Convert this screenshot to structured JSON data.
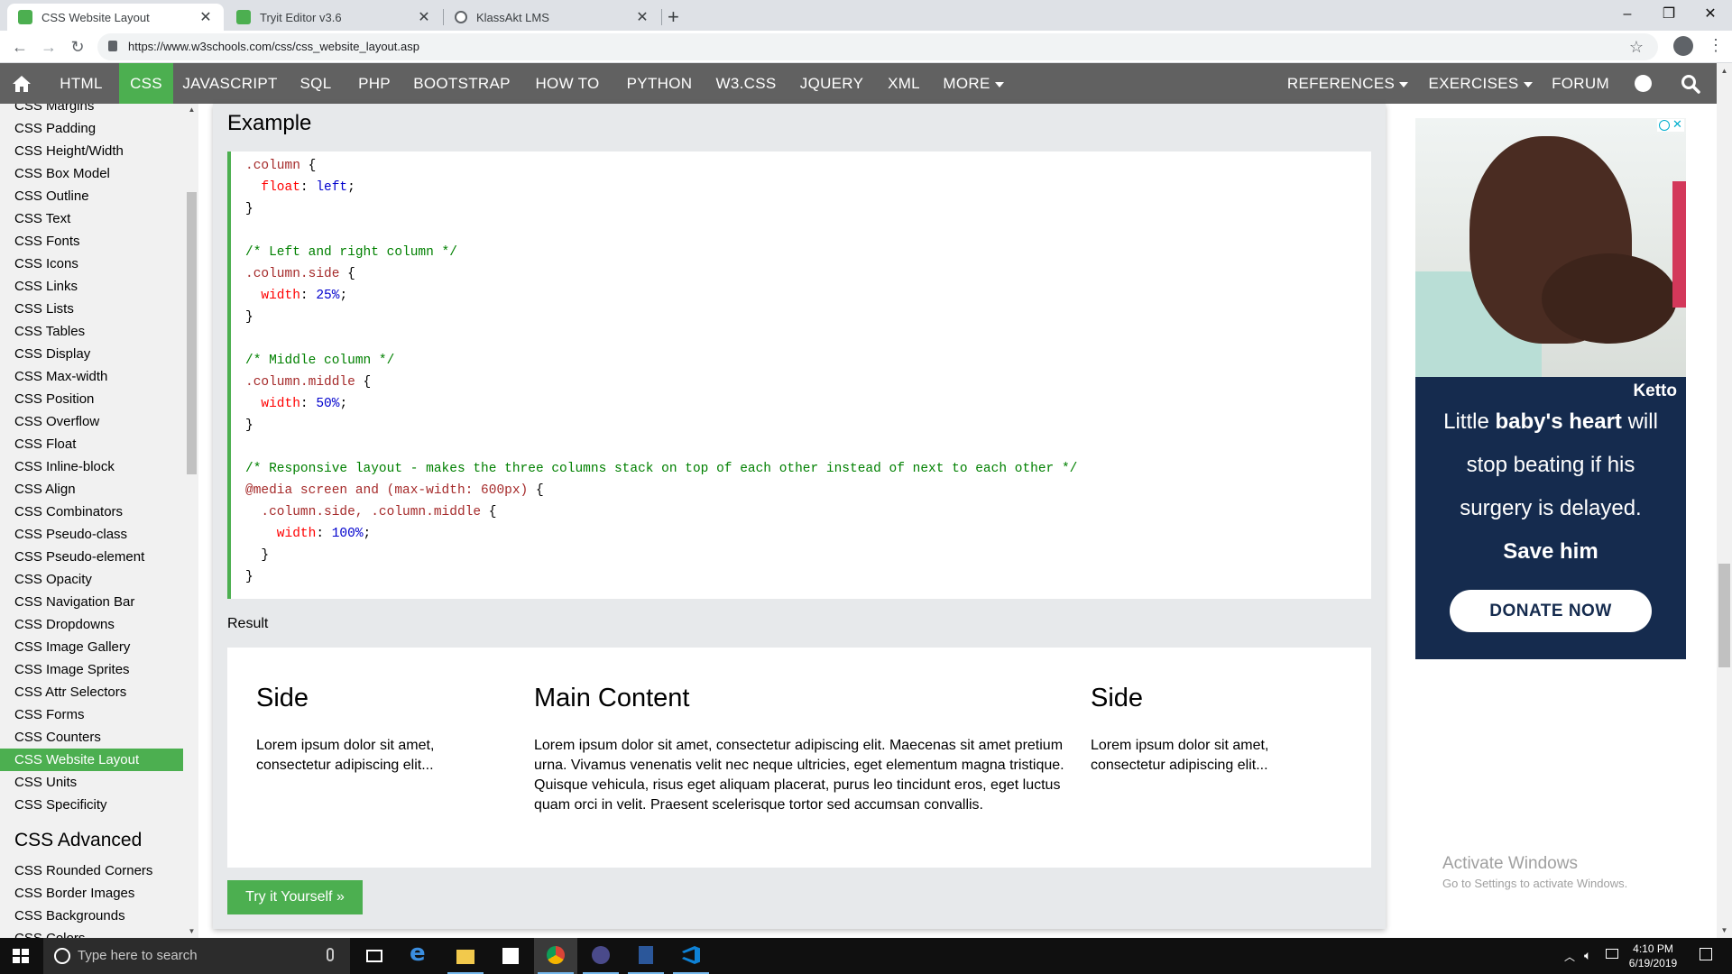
{
  "browser": {
    "tabs": [
      {
        "title": "CSS Website Layout",
        "active": true
      },
      {
        "title": "Tryit Editor v3.6",
        "active": false
      },
      {
        "title": "KlassAkt LMS",
        "active": false
      }
    ],
    "url": "https://www.w3schools.com/css/css_website_layout.asp"
  },
  "topnav": {
    "items": [
      "HTML",
      "CSS",
      "JAVASCRIPT",
      "SQL",
      "PHP",
      "BOOTSTRAP",
      "HOW TO",
      "PYTHON",
      "W3.CSS",
      "JQUERY",
      "XML",
      "MORE"
    ],
    "active": "CSS",
    "right_items": [
      "REFERENCES",
      "EXERCISES",
      "FORUM"
    ]
  },
  "sidebar": {
    "partial_top": "CSS Margins",
    "items": [
      "CSS Padding",
      "CSS Height/Width",
      "CSS Box Model",
      "CSS Outline",
      "CSS Text",
      "CSS Fonts",
      "CSS Icons",
      "CSS Links",
      "CSS Lists",
      "CSS Tables",
      "CSS Display",
      "CSS Max-width",
      "CSS Position",
      "CSS Overflow",
      "CSS Float",
      "CSS Inline-block",
      "CSS Align",
      "CSS Combinators",
      "CSS Pseudo-class",
      "CSS Pseudo-element",
      "CSS Opacity",
      "CSS Navigation Bar",
      "CSS Dropdowns",
      "CSS Image Gallery",
      "CSS Image Sprites",
      "CSS Attr Selectors",
      "CSS Forms",
      "CSS Counters",
      "CSS Website Layout",
      "CSS Units",
      "CSS Specificity"
    ],
    "active": "CSS Website Layout",
    "advanced_heading": "CSS Advanced",
    "advanced_items": [
      "CSS Rounded Corners",
      "CSS Border Images",
      "CSS Backgrounds"
    ],
    "partial_bottom": "CSS Colors"
  },
  "example": {
    "title": "Example",
    "code_lines": [
      [
        {
          "t": ".column",
          "c": "sel"
        },
        {
          "t": " {",
          "c": ""
        }
      ],
      [
        {
          "t": "  float",
          "c": "prop"
        },
        {
          "t": ": ",
          "c": ""
        },
        {
          "t": "left",
          "c": "val"
        },
        {
          "t": ";",
          "c": ""
        }
      ],
      [
        {
          "t": "}",
          "c": ""
        }
      ],
      [],
      [
        {
          "t": "/* Left and right column */",
          "c": "cmt"
        }
      ],
      [
        {
          "t": ".column.side",
          "c": "sel"
        },
        {
          "t": " {",
          "c": ""
        }
      ],
      [
        {
          "t": "  width",
          "c": "prop"
        },
        {
          "t": ": ",
          "c": ""
        },
        {
          "t": "25%",
          "c": "val"
        },
        {
          "t": ";",
          "c": ""
        }
      ],
      [
        {
          "t": "}",
          "c": ""
        }
      ],
      [],
      [
        {
          "t": "/* Middle column */",
          "c": "cmt"
        }
      ],
      [
        {
          "t": ".column.middle",
          "c": "sel"
        },
        {
          "t": " {",
          "c": ""
        }
      ],
      [
        {
          "t": "  width",
          "c": "prop"
        },
        {
          "t": ": ",
          "c": ""
        },
        {
          "t": "50%",
          "c": "val"
        },
        {
          "t": ";",
          "c": ""
        }
      ],
      [
        {
          "t": "}",
          "c": ""
        }
      ],
      [],
      [
        {
          "t": "/* Responsive layout - makes the three columns stack on top of each other instead of next to each other */",
          "c": "cmt"
        }
      ],
      [
        {
          "t": "@media screen and (max-width: 600px)",
          "c": "at"
        },
        {
          "t": " {",
          "c": ""
        }
      ],
      [
        {
          "t": "  .column.side, .column.middle",
          "c": "sel"
        },
        {
          "t": " {",
          "c": ""
        }
      ],
      [
        {
          "t": "    width",
          "c": "prop"
        },
        {
          "t": ": ",
          "c": ""
        },
        {
          "t": "100%",
          "c": "val"
        },
        {
          "t": ";",
          "c": ""
        }
      ],
      [
        {
          "t": "  }",
          "c": ""
        }
      ],
      [
        {
          "t": "}",
          "c": ""
        }
      ]
    ],
    "result_label": "Result",
    "columns": [
      {
        "heading": "Side",
        "text": "Lorem ipsum dolor sit amet, consectetur adipiscing elit..."
      },
      {
        "heading": "Main Content",
        "text": "Lorem ipsum dolor sit amet, consectetur adipiscing elit. Maecenas sit amet pretium urna. Vivamus venenatis velit nec neque ultricies, eget elementum magna tristique. Quisque vehicula, risus eget aliquam placerat, purus leo tincidunt eros, eget luctus quam orci in velit. Praesent scelerisque tortor sed accumsan convallis."
      },
      {
        "heading": "Side",
        "text": "Lorem ipsum dolor sit amet, consectetur adipiscing elit..."
      }
    ],
    "try_button": "Try it Yourself »"
  },
  "ad": {
    "brand": "Ketto",
    "line1_pre": "Little ",
    "line1_bold": "baby's heart",
    "line1_post": " will",
    "line2": "stop beating if his",
    "line3": "surgery is delayed.",
    "line4": "Save him",
    "button": "DONATE NOW"
  },
  "watermark": {
    "line1": "Activate Windows",
    "line2": "Go to Settings to activate Windows."
  },
  "taskbar": {
    "search_placeholder": "Type here to search",
    "time": "4:10 PM",
    "date": "6/19/2019"
  },
  "colors": {
    "accent": "#4caf50",
    "nav_bg": "#616161",
    "ad_bg": "#152b4e"
  }
}
